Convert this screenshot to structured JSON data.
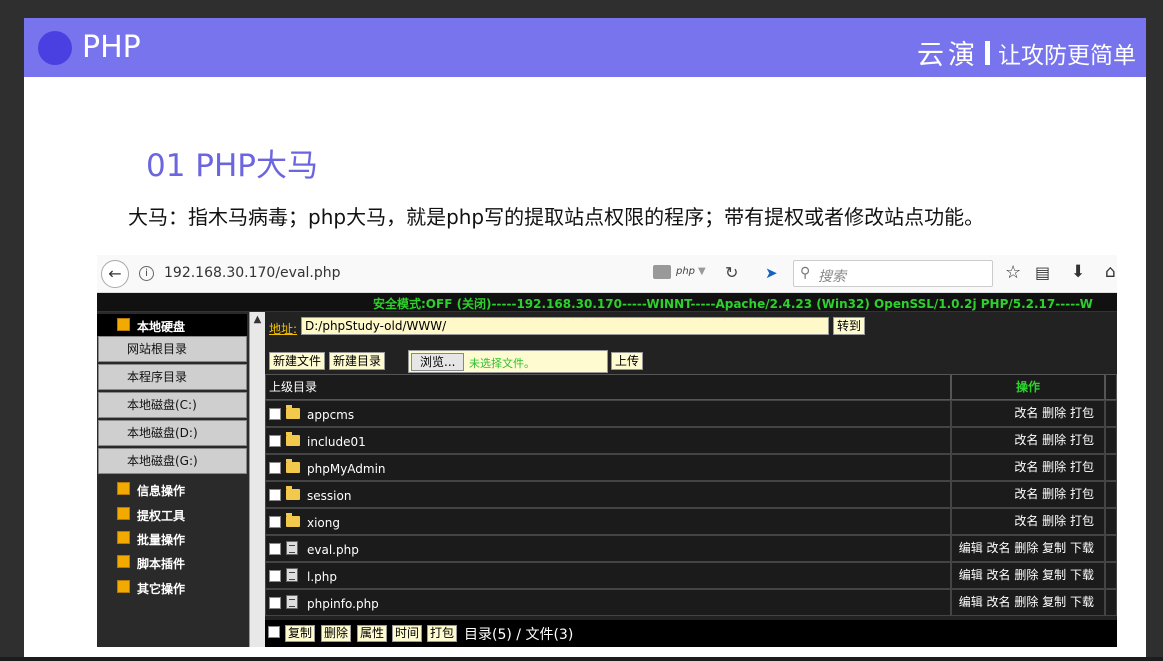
{
  "slide": {
    "header_title": "PHP",
    "brand_name": "云演",
    "brand_slogan": "让攻防更简单",
    "section_title": "01 PHP大马",
    "description": "大马：指木马病毒；php大马，就是php写的提取站点权限的程序；带有提权或者修改站点功能。"
  },
  "browser": {
    "url": "192.168.30.170/eval.php",
    "php_label": "php",
    "search_placeholder": "搜索",
    "icons": [
      "back-arrow-icon",
      "info-icon",
      "server-icon",
      "reload-icon",
      "extension-icon",
      "search-icon",
      "star-icon",
      "reader-icon",
      "download-icon",
      "home-icon"
    ]
  },
  "page": {
    "status": "安全模式:OFF (关闭)-----192.168.30.170-----WINNT-----Apache/2.4.23 (Win32) OpenSSL/1.0.2j PHP/5.2.17-----W",
    "nav": {
      "local_disk_head": "本地硬盘",
      "buttons": [
        "网站根目录",
        "本程序目录",
        "本地磁盘(C:)",
        "本地磁盘(D:)",
        "本地磁盘(G:)"
      ],
      "items": [
        "信息操作",
        "提权工具",
        "批量操作",
        "脚本插件",
        "其它操作"
      ]
    },
    "address_label": "地址:",
    "address_value": "D:/phpStudy-old/WWW/",
    "go_label": "转到",
    "new_file_label": "新建文件",
    "new_dir_label": "新建目录",
    "browse_label": "浏览...",
    "no_file_label": "未选择文件。",
    "upload_label": "上传",
    "table": {
      "parent_dir": "上级目录",
      "ops_header": "操作",
      "rows": [
        {
          "type": "folder",
          "name": "appcms",
          "ops": "改名 删除 打包"
        },
        {
          "type": "folder",
          "name": "include01",
          "ops": "改名 删除 打包"
        },
        {
          "type": "folder",
          "name": "phpMyAdmin",
          "ops": "改名 删除 打包"
        },
        {
          "type": "folder",
          "name": "session",
          "ops": "改名 删除 打包"
        },
        {
          "type": "folder",
          "name": "xiong",
          "ops": "改名 删除 打包"
        },
        {
          "type": "file",
          "name": "eval.php",
          "ops": "编辑 改名 删除 复制 下载"
        },
        {
          "type": "file",
          "name": "l.php",
          "ops": "编辑 改名 删除 复制 下载"
        },
        {
          "type": "file",
          "name": "phpinfo.php",
          "ops": "编辑 改名 删除 复制 下载"
        }
      ]
    },
    "footer": {
      "buttons": [
        "复制",
        "删除",
        "属性",
        "时间",
        "打包"
      ],
      "count": "目录(5) / 文件(3)"
    },
    "colors": {
      "header_band": "#7774ee",
      "status_green": "#2ed02e",
      "nav_icon_orange": "#f2a900"
    }
  }
}
